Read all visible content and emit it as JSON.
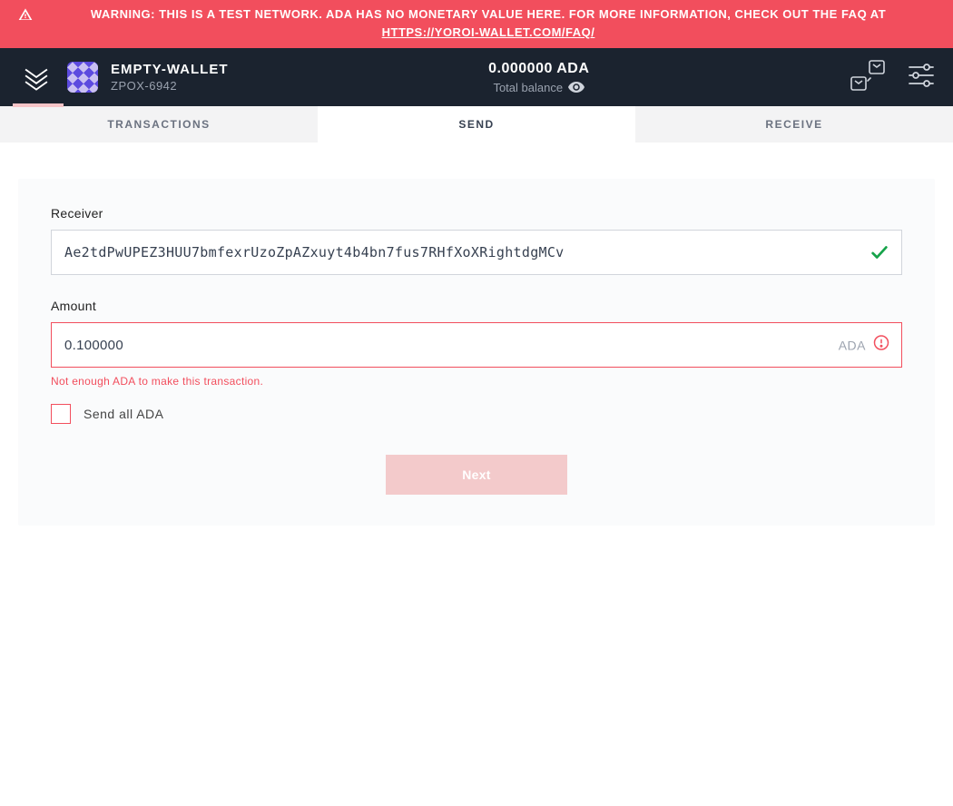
{
  "warning": {
    "text": "WARNING: THIS IS A TEST NETWORK. ADA HAS NO MONETARY VALUE HERE. FOR MORE INFORMATION, CHECK OUT THE FAQ AT ",
    "link_text": "HTTPS://YOROI-WALLET.COM/FAQ/"
  },
  "header": {
    "wallet_name": "EMPTY-WALLET",
    "wallet_plate": "ZPOX-6942",
    "balance_value": "0.000000 ADA",
    "balance_label": "Total balance"
  },
  "tabs": {
    "transactions": "TRANSACTIONS",
    "send": "SEND",
    "receive": "RECEIVE",
    "active": "send"
  },
  "form": {
    "receiver_label": "Receiver",
    "receiver_value": "Ae2tdPwUPEZ3HUU7bmfexrUzoZpAZxuyt4b4bn7fus7RHfXoXRightdgMCv",
    "receiver_valid": true,
    "amount_label": "Amount",
    "amount_value": "0.100000",
    "amount_suffix": "ADA",
    "amount_error": "Not enough ADA to make this transaction.",
    "send_all_label": "Send all ADA",
    "send_all_checked": false,
    "next_label": "Next",
    "next_enabled": false
  },
  "colors": {
    "accent_error": "#f24e5d",
    "header_bg": "#1b232f"
  }
}
